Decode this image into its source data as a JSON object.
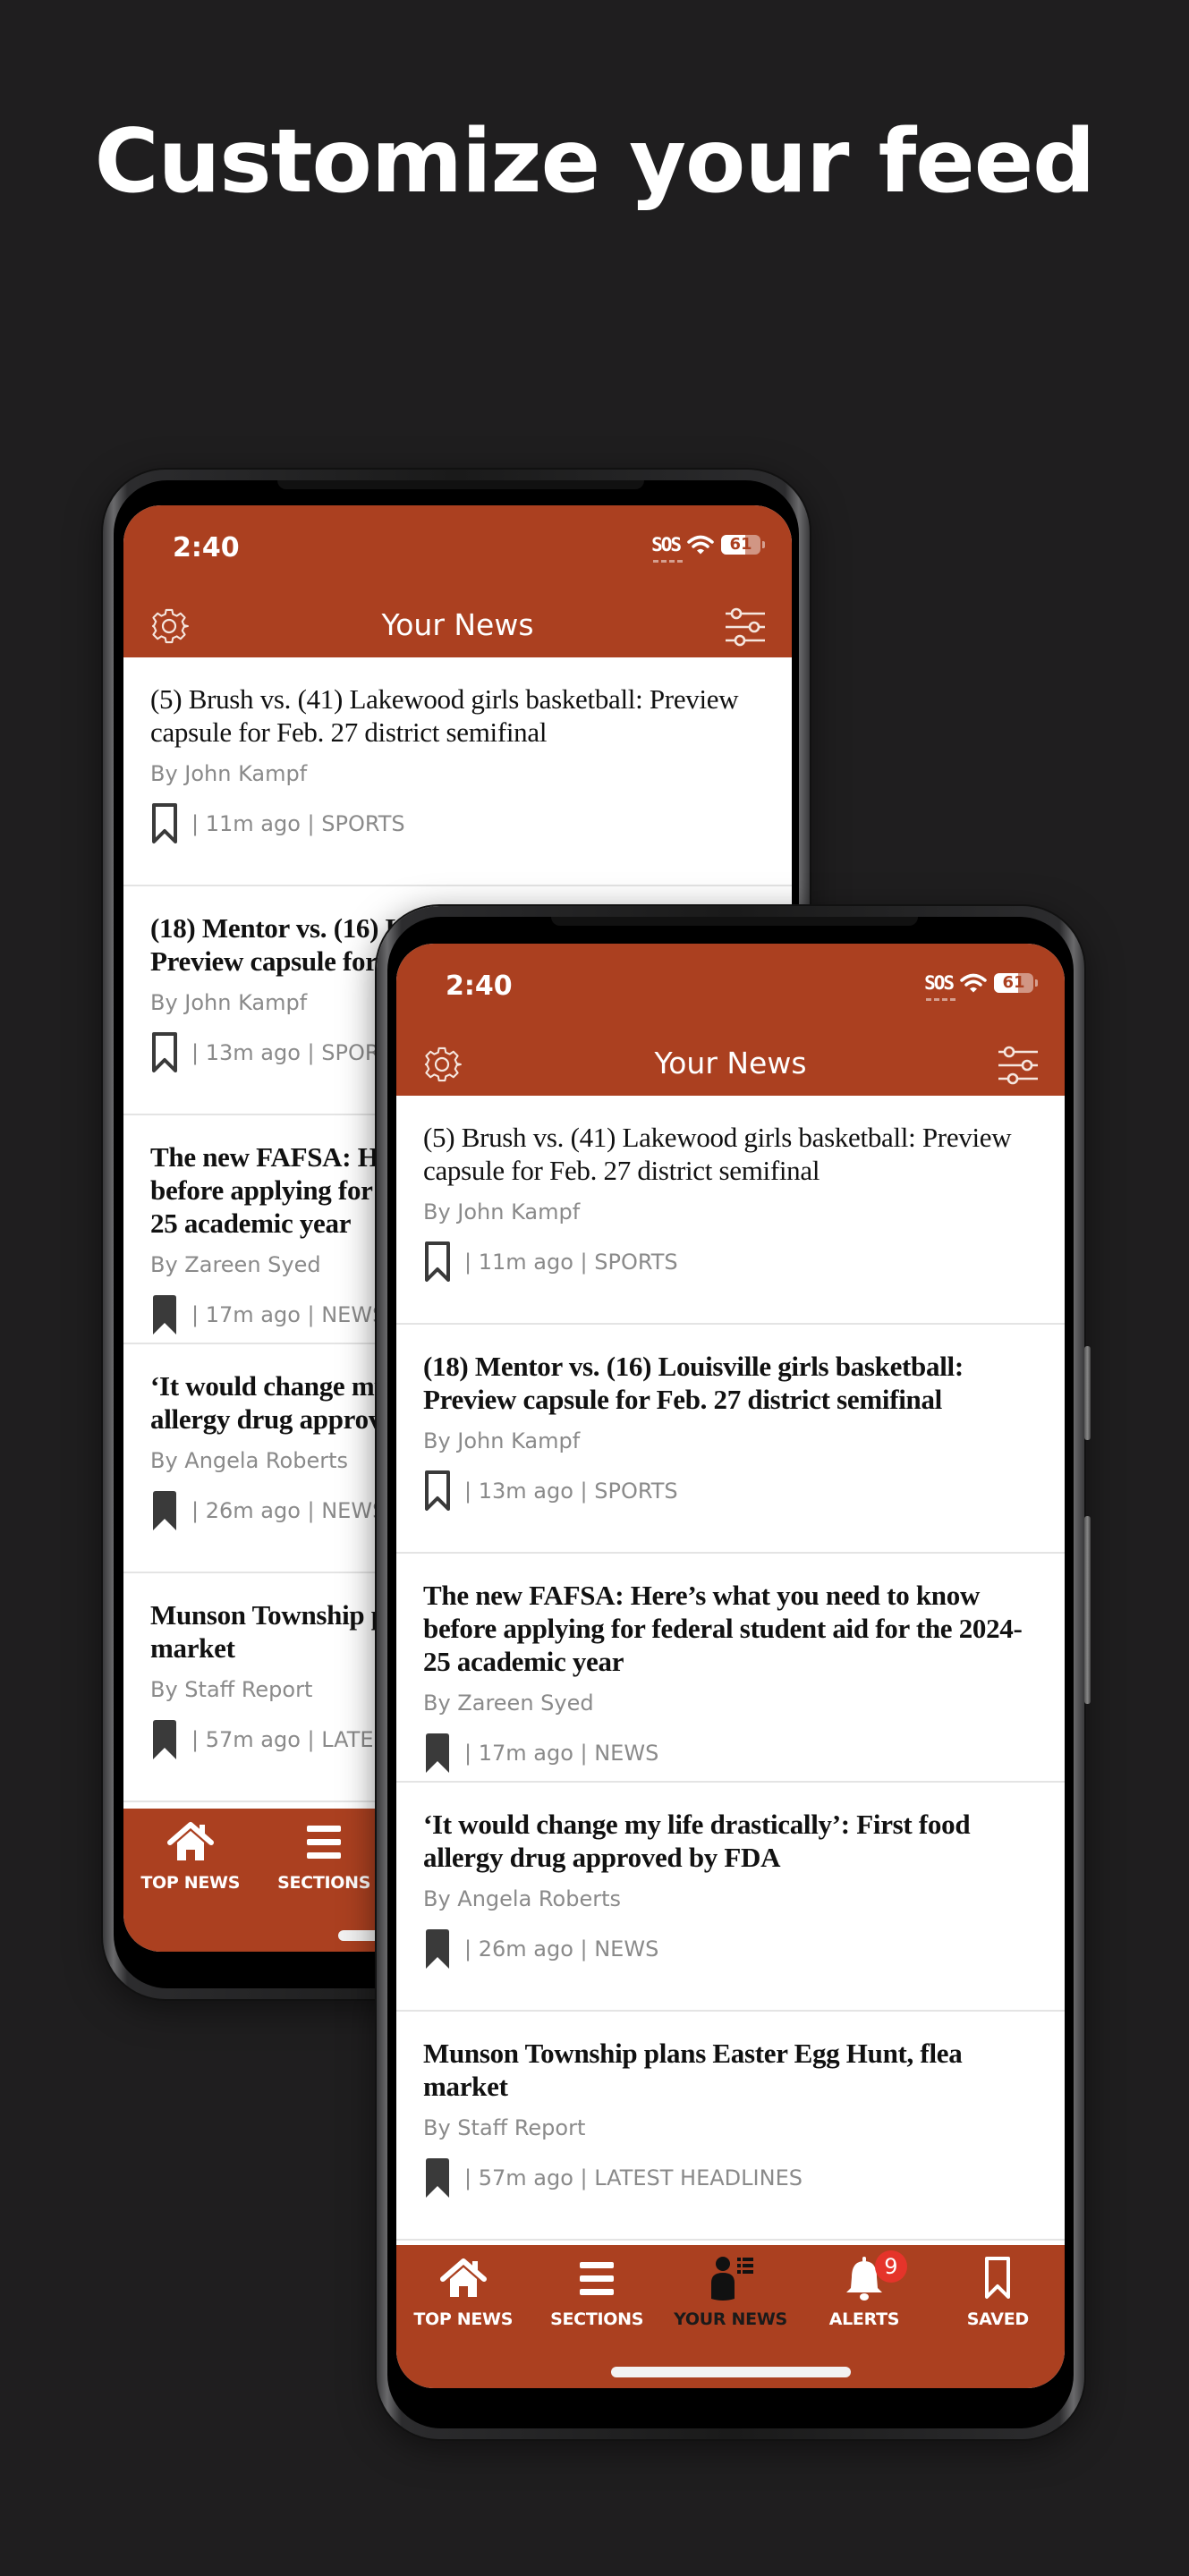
{
  "promo": {
    "title": "Customize your feed"
  },
  "colors": {
    "brand": "#ab4020",
    "badge": "#e5342a",
    "background": "#1f1e1f"
  },
  "status_bar": {
    "time": "2:40",
    "carrier": "SOS",
    "wifi_icon": "wifi-icon",
    "battery_percent": 61,
    "battery_label": "61"
  },
  "header": {
    "title": "Your News",
    "left_icon": "gear-icon",
    "right_icon": "sliders-icon"
  },
  "articles": [
    {
      "headline": "(5) Brush vs. (41) Lakewood girls basketball: Preview capsule for Feb. 27 district semifinal",
      "byline": "By John Kampf",
      "meta": "| 11m ago | SPORTS",
      "read": true,
      "saved": false
    },
    {
      "headline": "(18) Mentor vs. (16) Louisville girls basketball: Preview capsule for Feb. 27 district semifinal",
      "byline": "By John Kampf",
      "meta": "| 13m ago | SPORTS",
      "read": false,
      "saved": false
    },
    {
      "headline": "The new FAFSA: Here’s what you need to know before applying for federal student aid for the 2024-25 academic year",
      "byline": "By Zareen Syed",
      "meta": "| 17m ago | NEWS",
      "read": false,
      "saved": true
    },
    {
      "headline": "‘It would change my life drastically’: First food allergy drug approved by FDA",
      "byline": "By Angela Roberts",
      "meta": "| 26m ago | NEWS",
      "read": false,
      "saved": true
    },
    {
      "headline": "Munson Township plans Easter Egg Hunt, flea market",
      "byline": "By Staff Report",
      "meta": "| 57m ago | LATEST HEADLINES",
      "read": false,
      "saved": true
    }
  ],
  "bottom_nav": [
    {
      "label": "TOP NEWS",
      "icon": "home-icon",
      "active": false
    },
    {
      "label": "SECTIONS",
      "icon": "menu-icon",
      "active": false
    },
    {
      "label": "YOUR NEWS",
      "icon": "person-list-icon",
      "active": true
    },
    {
      "label": "ALERTS",
      "icon": "bell-icon",
      "active": false,
      "badge": "9"
    },
    {
      "label": "SAVED",
      "icon": "bookmark-icon",
      "active": false
    }
  ]
}
